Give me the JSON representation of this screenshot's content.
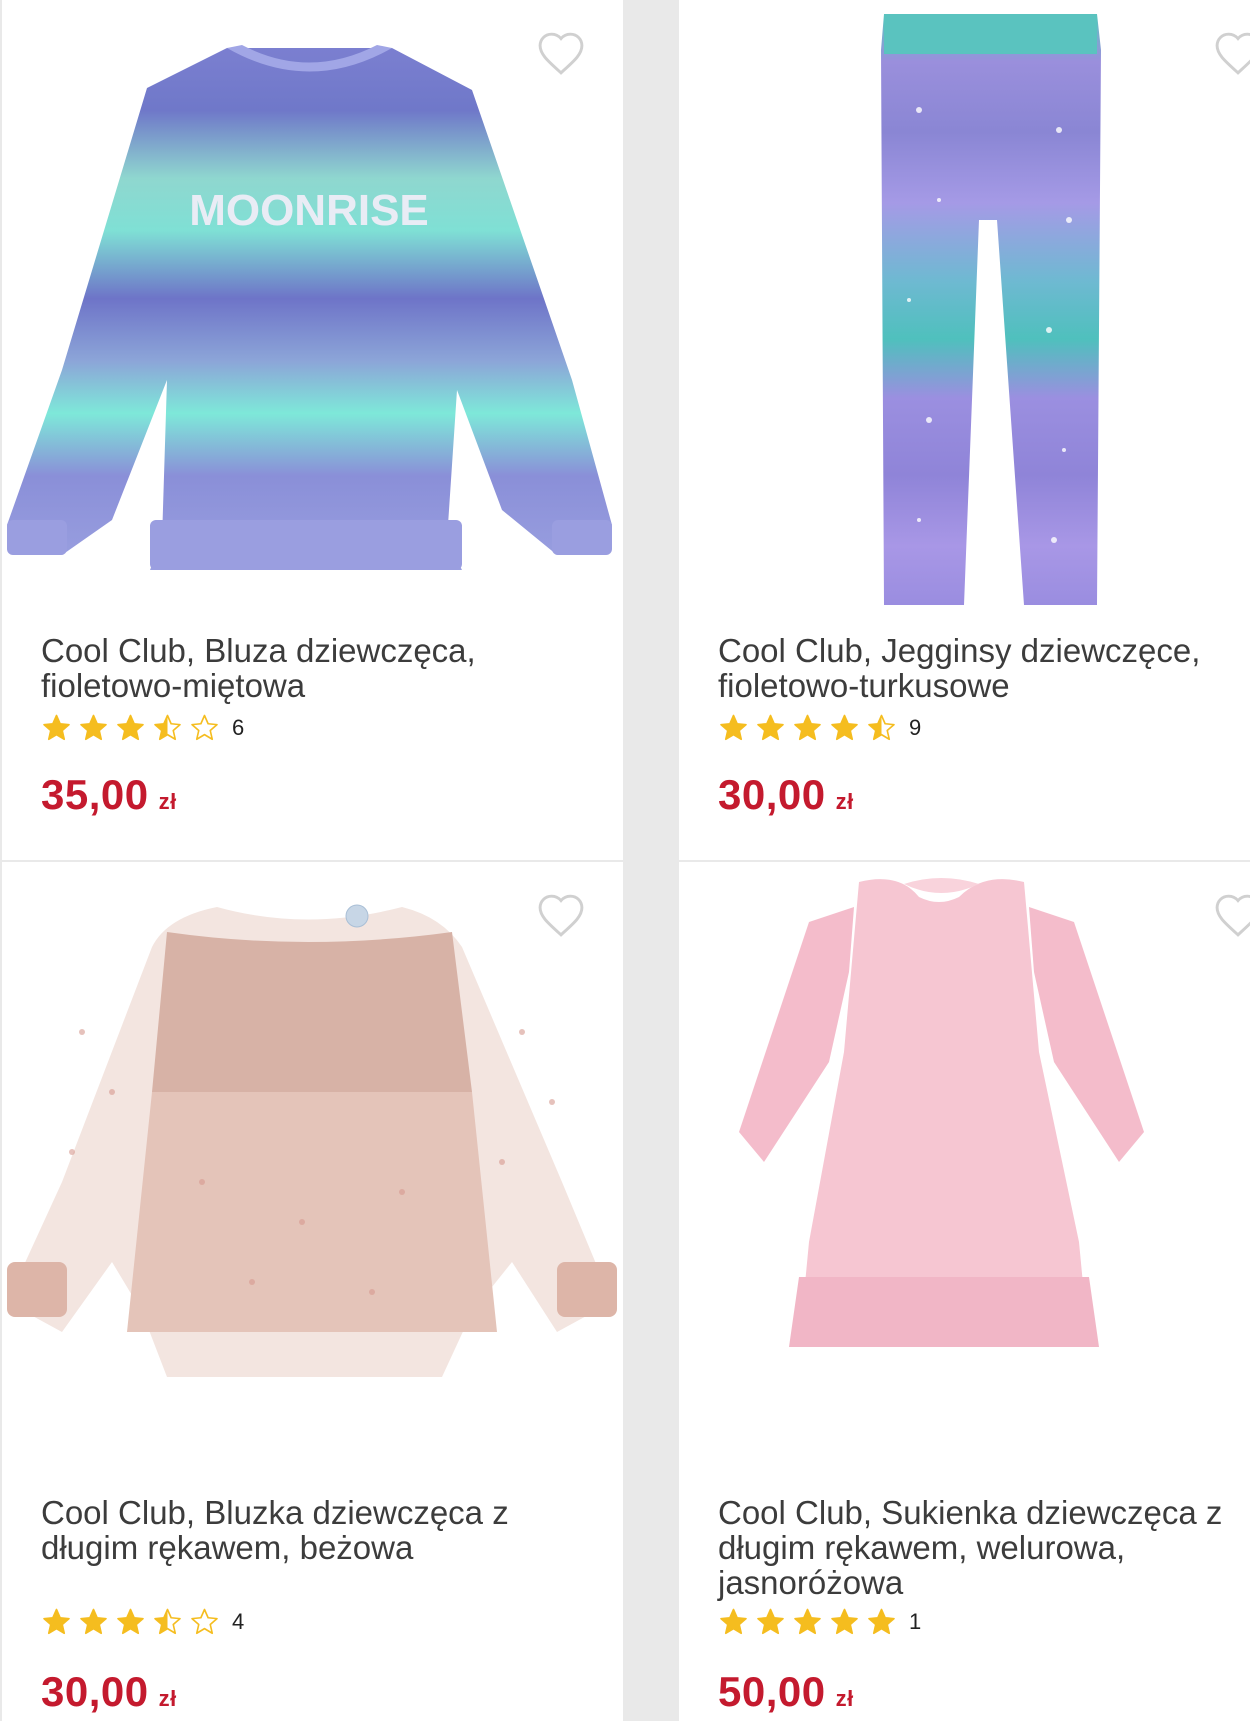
{
  "products": [
    {
      "title": "Cool Club, Bluza dziewczęca, fioletowo-miętowa",
      "rating": 3.5,
      "reviews": "6",
      "price": "35,00",
      "currency": "zł",
      "print_text": "MOONRISE"
    },
    {
      "title": "Cool Club, Jegginsy dziewczęce, fioletowo-turkusowe",
      "rating": 4.5,
      "reviews": "9",
      "price": "30,00",
      "currency": "zł"
    },
    {
      "title": "Cool Club, Bluzka dziewczęca z długim rękawem, beżowa",
      "rating": 3.5,
      "reviews": "4",
      "price": "30,00",
      "currency": "zł"
    },
    {
      "title": "Cool Club, Sukienka dziewczęca z długim rękawem, welurowa, jasnoróżowa",
      "rating": 5,
      "reviews": "1",
      "price": "50,00",
      "currency": "zł"
    }
  ],
  "colors": {
    "price": "#c41a2e",
    "star": "#f5bd1f",
    "heart_outline": "#d0d0d0",
    "background": "#e9e9e9"
  },
  "icons": {
    "favorite": "heart-outline-icon",
    "rating": "star-icon"
  }
}
